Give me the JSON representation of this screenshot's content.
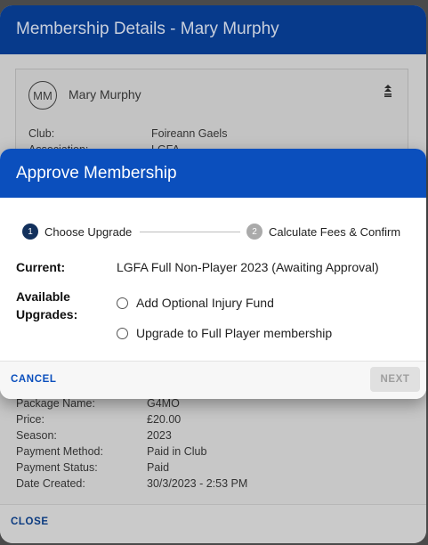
{
  "membership": {
    "title": "Membership Details - Mary Murphy",
    "card": {
      "initials": "MM",
      "name": "Mary Murphy",
      "details_top": [
        {
          "label": "Club:",
          "value": "Foireann Gaels"
        },
        {
          "label": "Association:",
          "value": "LGFA"
        }
      ],
      "details_bottom": [
        {
          "label": "Package Name:",
          "value": "G4MO"
        },
        {
          "label": "Price:",
          "value": "£20.00"
        },
        {
          "label": "Season:",
          "value": "2023"
        },
        {
          "label": "Payment Method:",
          "value": "Paid in Club"
        },
        {
          "label": "Payment Status:",
          "value": "Paid"
        },
        {
          "label": "Date Created:",
          "value": "30/3/2023 - 2:53 PM"
        }
      ]
    },
    "close_label": "CLOSE"
  },
  "dialog": {
    "title": "Approve Membership",
    "steps": [
      {
        "number": "1",
        "label": "Choose Upgrade"
      },
      {
        "number": "2",
        "label": "Calculate Fees & Confirm"
      }
    ],
    "current_label": "Current:",
    "current_value": "LGFA Full Non-Player 2023 (Awaiting Approval)",
    "upgrades_label_1": "Available",
    "upgrades_label_2": "Upgrades:",
    "options": [
      {
        "label": "Add Optional Injury Fund"
      },
      {
        "label": "Upgrade to Full Player membership"
      }
    ],
    "cancel_label": "CANCEL",
    "next_label": "NEXT"
  },
  "colors": {
    "header_blue": "#0b4fbd",
    "overlay_header": "#073a8b",
    "step_active": "#12305c"
  }
}
